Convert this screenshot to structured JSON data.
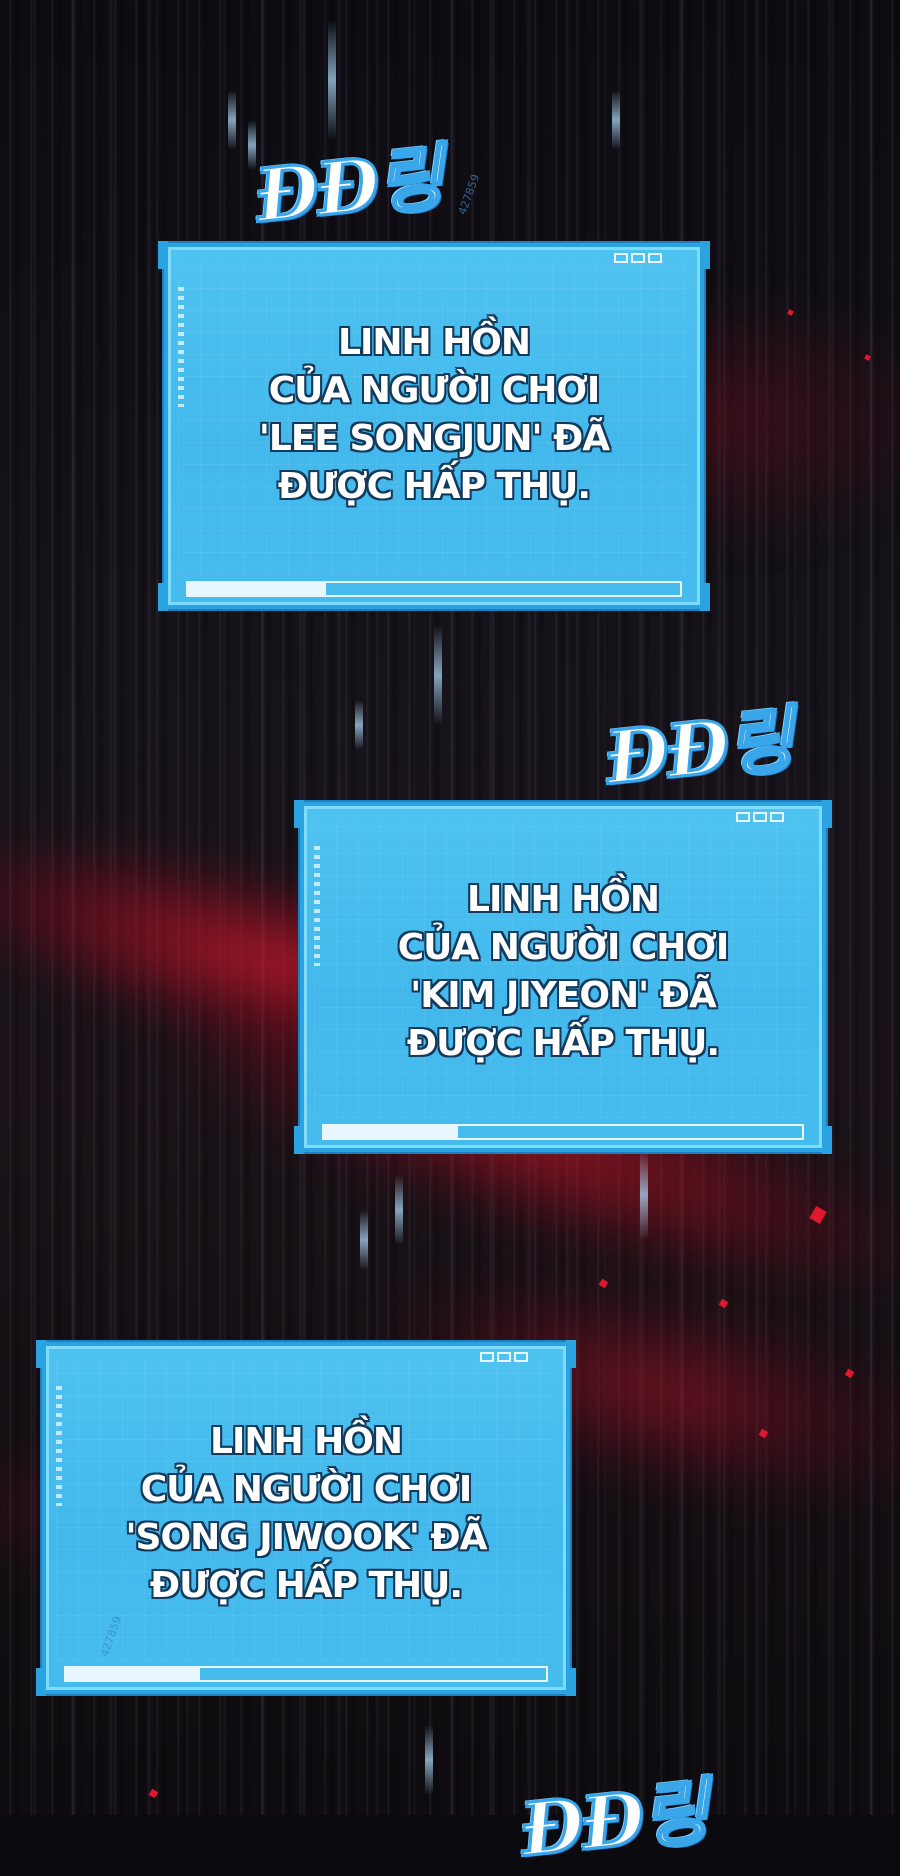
{
  "sfx": {
    "top": "ĐĐ링",
    "middle": "ĐĐ링",
    "bottom": "ĐĐ링"
  },
  "panels": [
    {
      "lines": [
        "LINH HỒN",
        "CỦA NGƯỜI CHƠI",
        "'LEE SONGJUN' ĐÃ",
        "ĐƯỢC HẤP THỤ."
      ]
    },
    {
      "lines": [
        "LINH HỒN",
        "CỦA NGƯỜI CHƠI",
        "'KIM JIYEON' ĐÃ",
        "ĐƯỢC HẤP THỤ."
      ]
    },
    {
      "lines": [
        "LINH HỒN",
        "CỦA NGƯỜI CHƠI",
        "'SONG JIWOOK' ĐÃ",
        "ĐƯỢC HẤP THỤ."
      ]
    }
  ],
  "watermarks": [
    "427859",
    "427859"
  ],
  "colors": {
    "panel": "#46bcee",
    "panel_border": "#2aa3e0",
    "text_outline": "#123a5c",
    "accent_red": "#e0182e"
  }
}
